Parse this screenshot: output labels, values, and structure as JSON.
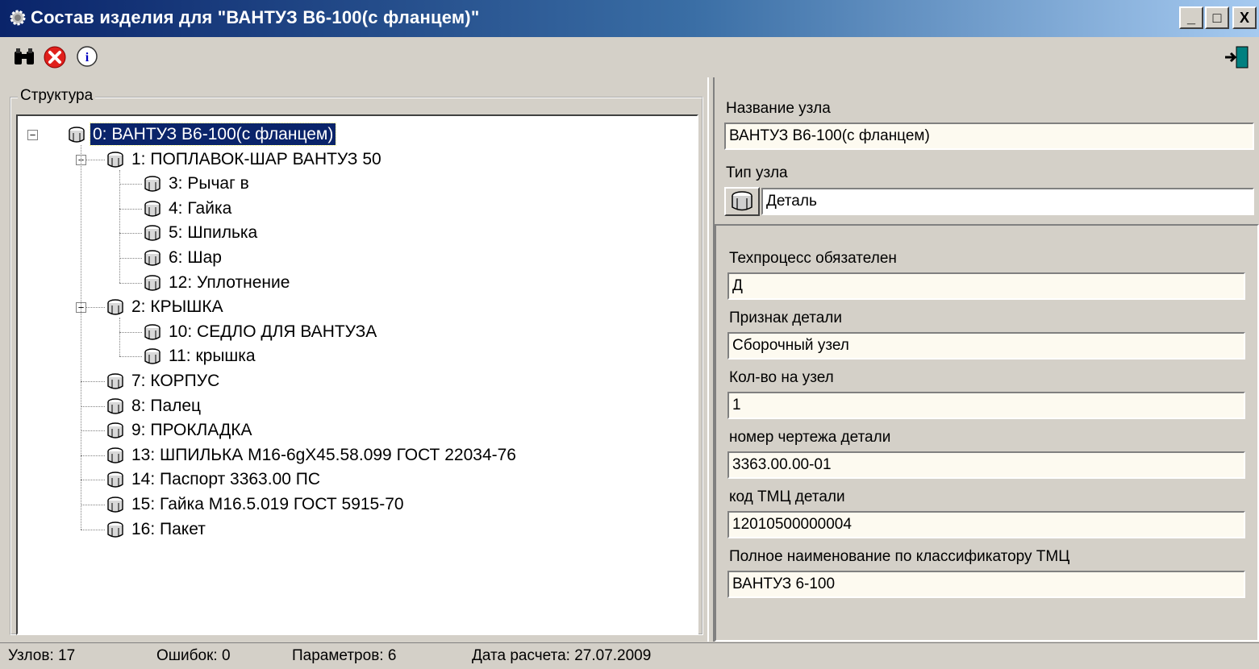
{
  "window": {
    "title": "Состав изделия для \"ВАНТУЗ В6-100(с фланцем)\"",
    "minimize": "_",
    "maximize": "□",
    "close": "X"
  },
  "toolbar": {
    "items": [
      {
        "icon": "binoculars-icon"
      },
      {
        "icon": "cancel-icon"
      },
      {
        "icon": "info-icon"
      }
    ],
    "exit_icon": "exit-door-icon"
  },
  "structure": {
    "group_label": "Структура",
    "nodes": [
      {
        "label": "0:  ВАНТУЗ В6-100(с фланцем)",
        "selected": true
      },
      {
        "label": "1:  ПОПЛАВОК-ШАР ВАНТУЗ 50"
      },
      {
        "label": "3:  Рычаг в"
      },
      {
        "label": "4:  Гайка"
      },
      {
        "label": "5:  Шпилька"
      },
      {
        "label": "6:  Шар"
      },
      {
        "label": "12:  Уплотнение"
      },
      {
        "label": "2:  КРЫШКА"
      },
      {
        "label": "10:  СЕДЛО ДЛЯ ВАНТУЗА"
      },
      {
        "label": "11:  крышка"
      },
      {
        "label": "7:  КОРПУС"
      },
      {
        "label": "8:  Палец"
      },
      {
        "label": "9:  ПРОКЛАДКА"
      },
      {
        "label": "13:  ШПИЛЬКА М16-6gX45.58.099  ГОСТ 22034-76"
      },
      {
        "label": "14:  Паспорт 3363.00 ПС"
      },
      {
        "label": "15:  Гайка М16.5.019 ГОСТ 5915-70"
      },
      {
        "label": "16:  Пакет"
      }
    ]
  },
  "details": {
    "node_name_label": "Название узла",
    "node_name_value": "ВАНТУЗ В6-100(с фланцем)",
    "node_type_label": "Тип узла",
    "node_type_value": "Деталь",
    "params": [
      {
        "label": "Техпроцесс обязателен",
        "value": "Д"
      },
      {
        "label": "Признак детали",
        "value": "Сборочный узел"
      },
      {
        "label": "Кол-во на узел",
        "value": "1"
      },
      {
        "label": "номер чертежа детали",
        "value": "3363.00.00-01"
      },
      {
        "label": "код ТМЦ детали",
        "value": "12010500000004"
      },
      {
        "label": "Полное наименование по классификатору ТМЦ",
        "value": "ВАНТУЗ  6-100"
      }
    ]
  },
  "status": {
    "nodes": "Узлов: 17",
    "errors": "Ошибок: 0",
    "params": "Параметров: 6",
    "date": "Дата расчета: 27.07.2009"
  }
}
